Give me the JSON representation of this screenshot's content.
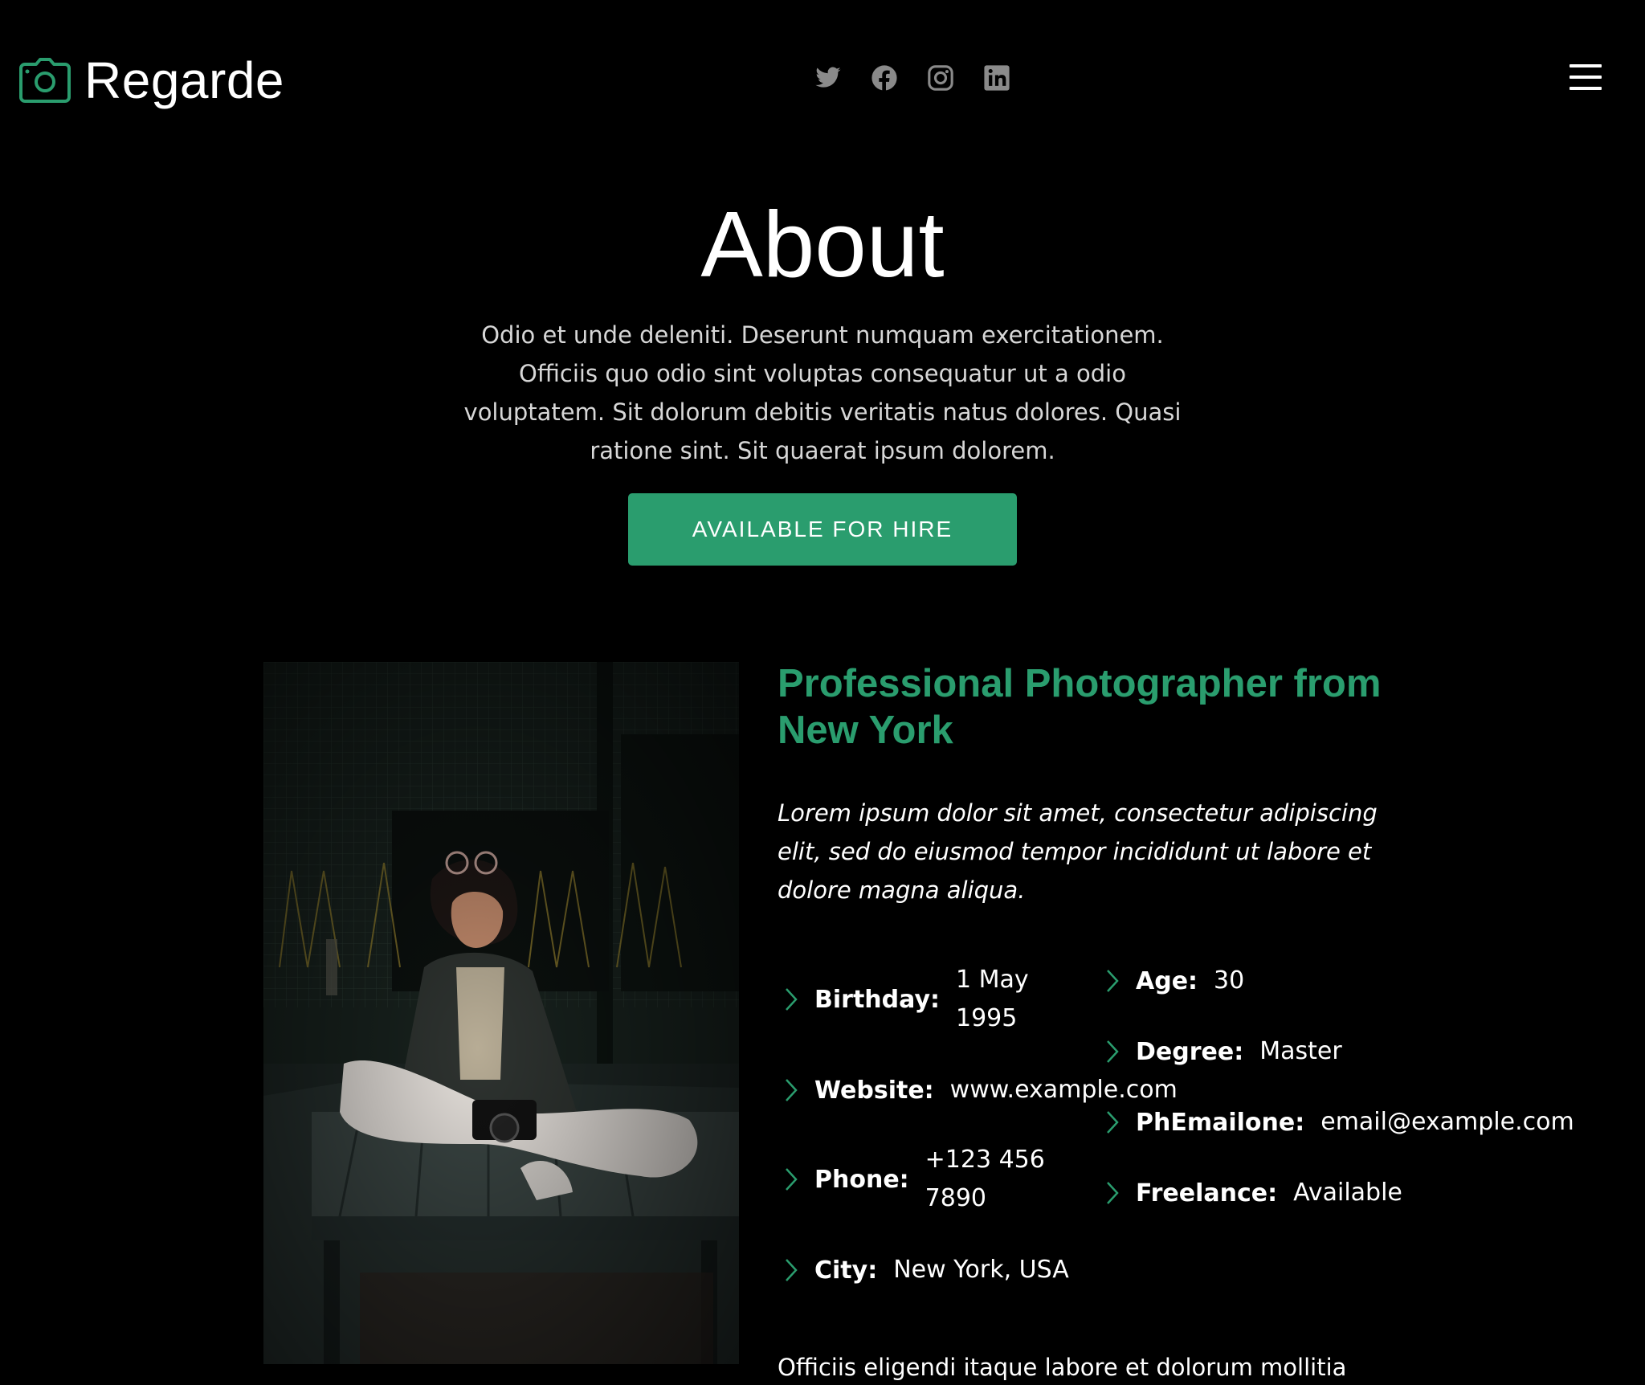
{
  "brand": {
    "name": "Regarde",
    "icon": "camera-icon",
    "accent_color": "#2a9d6e"
  },
  "social": [
    "twitter-icon",
    "facebook-icon",
    "instagram-icon",
    "linkedin-icon"
  ],
  "section": {
    "title": "About",
    "intro": "Odio et unde deleniti. Deserunt numquam exercitationem. Officiis quo odio sint voluptas consequatur ut a odio voluptatem. Sit dolorum debitis veritatis natus dolores. Quasi ratione sint. Sit quaerat ipsum dolorem.",
    "hire_button": "Available for hire"
  },
  "about": {
    "title": "Professional Photographer from New York",
    "lead": "Lorem ipsum dolor sit amet, consectetur adipiscing elit, sed do eiusmod tempor incididunt ut labore et dolore magna aliqua.",
    "details_left": [
      {
        "label": "Birthday:",
        "value": "1 May 1995"
      },
      {
        "label": "Website:",
        "value": "www.example.com"
      },
      {
        "label": "Phone:",
        "value": "+123 456 7890"
      },
      {
        "label": "City:",
        "value": "New York, USA"
      }
    ],
    "details_right": [
      {
        "label": "Age:",
        "value": "30"
      },
      {
        "label": "Degree:",
        "value": "Master"
      },
      {
        "label": "PhEmailone:",
        "value": "email@example.com"
      },
      {
        "label": "Freelance:",
        "value": "Available"
      }
    ],
    "outro": "Officiis eligendi itaque labore et dolorum mollitia"
  }
}
